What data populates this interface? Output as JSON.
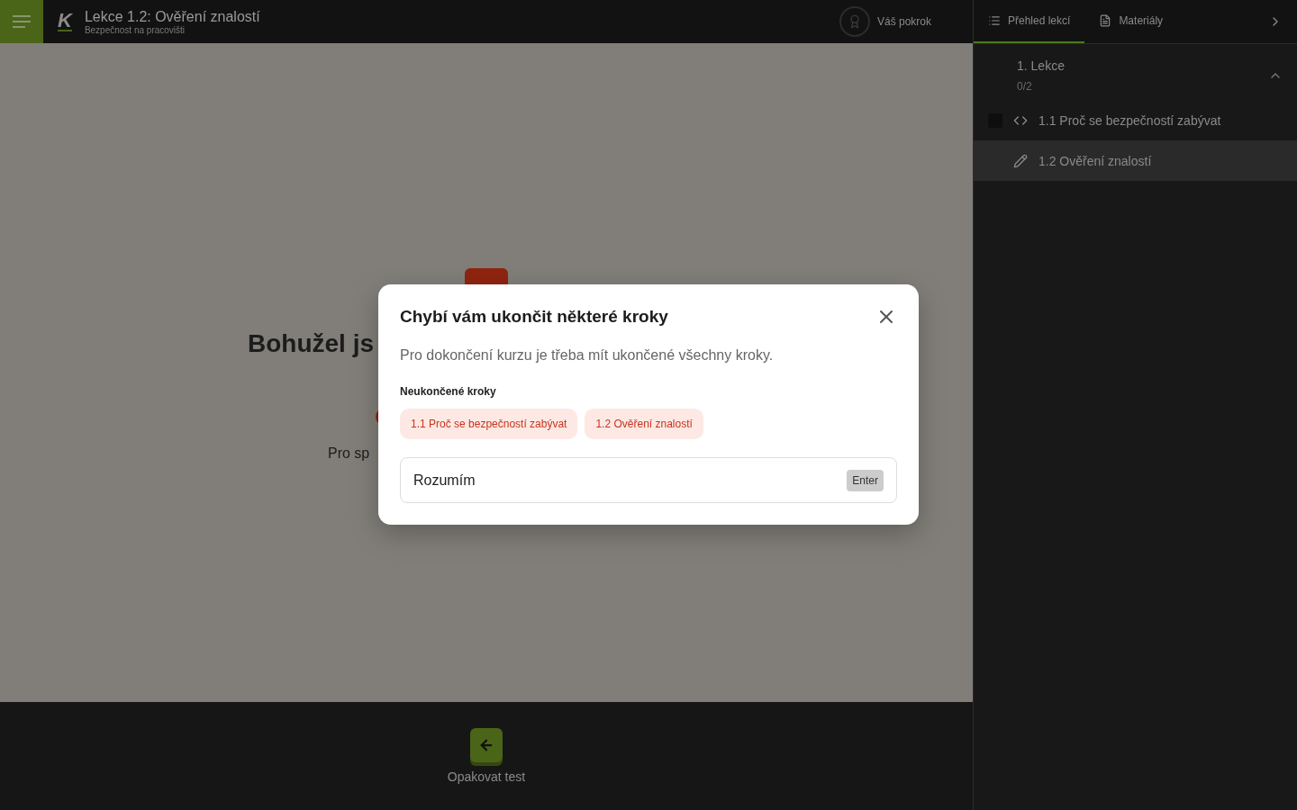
{
  "header": {
    "title": "Lekce 1.2: Ověření znalostí",
    "subtitle": "Bezpečnost na pracovišti",
    "logo": "K",
    "progress": "Váš pokrok"
  },
  "sidebar": {
    "tabs": [
      {
        "label": "Přehled lekcí",
        "kind": "list",
        "selected": true
      },
      {
        "label": "Materiály",
        "kind": "file",
        "selected": false
      }
    ],
    "section": {
      "title": "1. Lekce",
      "count": "0/2",
      "expanded": true
    },
    "items": [
      {
        "label": "1.1 Proč se bezpečností zabývat",
        "kind": "code",
        "selected": false,
        "checked": false
      },
      {
        "label": "1.2 Ověření znalostí",
        "kind": "edit",
        "selected": true
      }
    ]
  },
  "page": {
    "heading": "Bohužel js",
    "text": "Pro sp"
  },
  "footer": {
    "button": "Opakovat test"
  },
  "modal": {
    "title": "Chybí vám ukončit některé kroky",
    "text": "Pro dokončení kurzu je třeba mít ukončené všechny kroky.",
    "section_label": "Neukončené kroky",
    "steps": [
      "1.1 Proč se bezpečností zabývat",
      "1.2 Ověření znalostí"
    ],
    "confirm": {
      "label": "Rozumím",
      "key": "Enter"
    }
  }
}
